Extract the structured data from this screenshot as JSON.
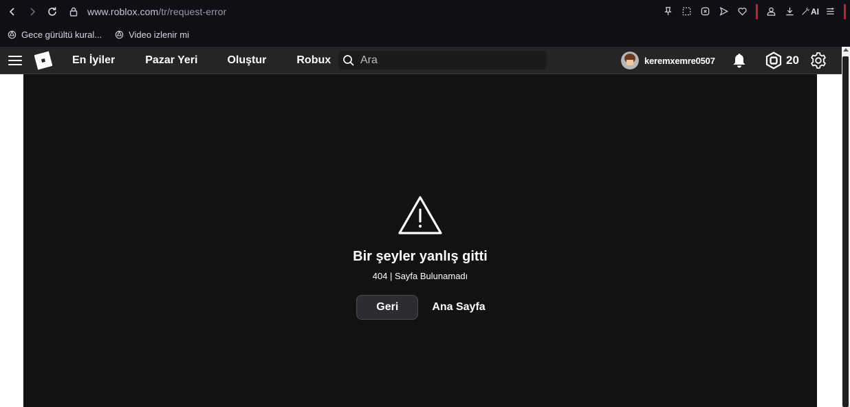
{
  "browser": {
    "url_domain": "www.roblox.com",
    "url_path": "/tr/request-error",
    "ai_label": "AI"
  },
  "bookmarks": [
    {
      "label": "Gece gürültü kural..."
    },
    {
      "label": "Video izlenir mi"
    }
  ],
  "header": {
    "nav": [
      "En İyiler",
      "Pazar Yeri",
      "Oluştur",
      "Robux"
    ],
    "search_placeholder": "Ara",
    "username": "keremxemre0507",
    "robux_count": "20"
  },
  "error": {
    "title": "Bir şeyler yanlış gitti",
    "subtitle": "404 | Sayfa Bulunamadı",
    "back_button": "Geri",
    "home_button": "Ana Sayfa"
  },
  "colors": {
    "browser_bg": "#0f0f15",
    "header_bg": "#232527",
    "content_bg": "#121213",
    "accent_red": "#c0213a"
  }
}
